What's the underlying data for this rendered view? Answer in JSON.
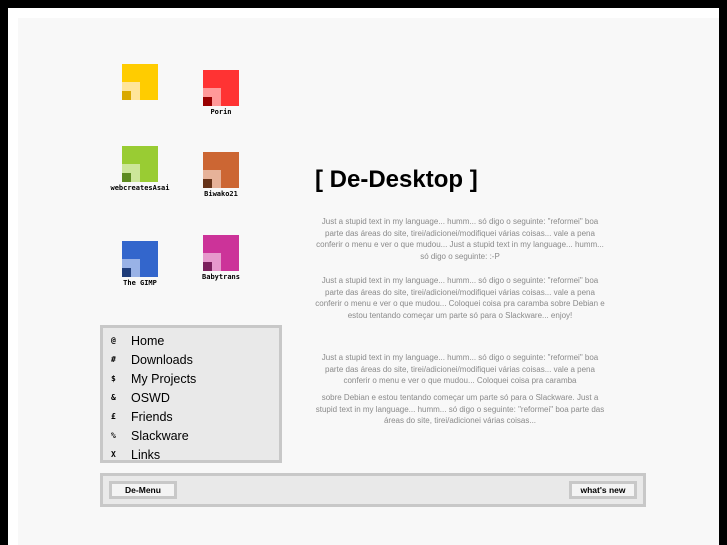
{
  "desktop_icons": [
    {
      "label": "",
      "colors": {
        "outer": "#ffcc00",
        "mid": "#ffe59a",
        "inner": "#d9a800"
      }
    },
    {
      "label": "Porin",
      "colors": {
        "outer": "#ff3333",
        "mid": "#ff9999",
        "inner": "#990000"
      }
    },
    {
      "label": "webcreatesAsai",
      "colors": {
        "outer": "#99cc33",
        "mid": "#cce699",
        "inner": "#5c8a1f"
      }
    },
    {
      "label": "Biwako21",
      "colors": {
        "outer": "#cc6633",
        "mid": "#e6b299",
        "inner": "#663319"
      }
    },
    {
      "label": "The GIMP",
      "colors": {
        "outer": "#3366cc",
        "mid": "#99b2e6",
        "inner": "#1f3d7a"
      }
    },
    {
      "label": "Babytrans",
      "colors": {
        "outer": "#cc3399",
        "mid": "#e699cc",
        "inner": "#7a1f5c"
      }
    }
  ],
  "menu": [
    {
      "key": "@",
      "label": "Home"
    },
    {
      "key": "#",
      "label": "Downloads"
    },
    {
      "key": "$",
      "label": "My Projects"
    },
    {
      "key": "&",
      "label": "OSWD"
    },
    {
      "key": "£",
      "label": "Friends"
    },
    {
      "key": "%",
      "label": "Slackware"
    },
    {
      "key": "X",
      "label": "Links"
    }
  ],
  "content": {
    "title": "[ De-Desktop ]",
    "paragraphs": [
      "Just a stupid text in my language... humm... só digo o seguinte: \"reformei\" boa parte das áreas do site, tirei/adicionei/modifiquei várias coisas... vale a pena conferir o menu e ver o que mudou... Just a stupid text in my language... humm... só digo o seguinte: :-P",
      "Just a stupid text in my language... humm... só digo o seguinte: \"reformei\" boa parte das áreas do site, tirei/adicionei/modifiquei várias coisas... vale a pena conferir o menu e ver o que mudou... Coloquei coisa pra caramba sobre Debian e estou tentando começar um parte só para o Slackware... enjoy!",
      "Just a stupid text in my language... humm... só digo o seguinte: \"reformei\" boa parte das áreas do site, tirei/adicionei/modifiquei várias coisas... vale a pena conferir o menu e ver o que mudou... Coloquei coisa pra caramba",
      "sobre Debian e estou tentando começar um parte só para o Slackware. Just a stupid text in my language... humm... só digo o seguinte: \"reformei\" boa parte das áreas do site, tirei/adicionei várias coisas..."
    ]
  },
  "bottom_bar": {
    "left_button": "De-Menu",
    "right_button": "what's new"
  }
}
